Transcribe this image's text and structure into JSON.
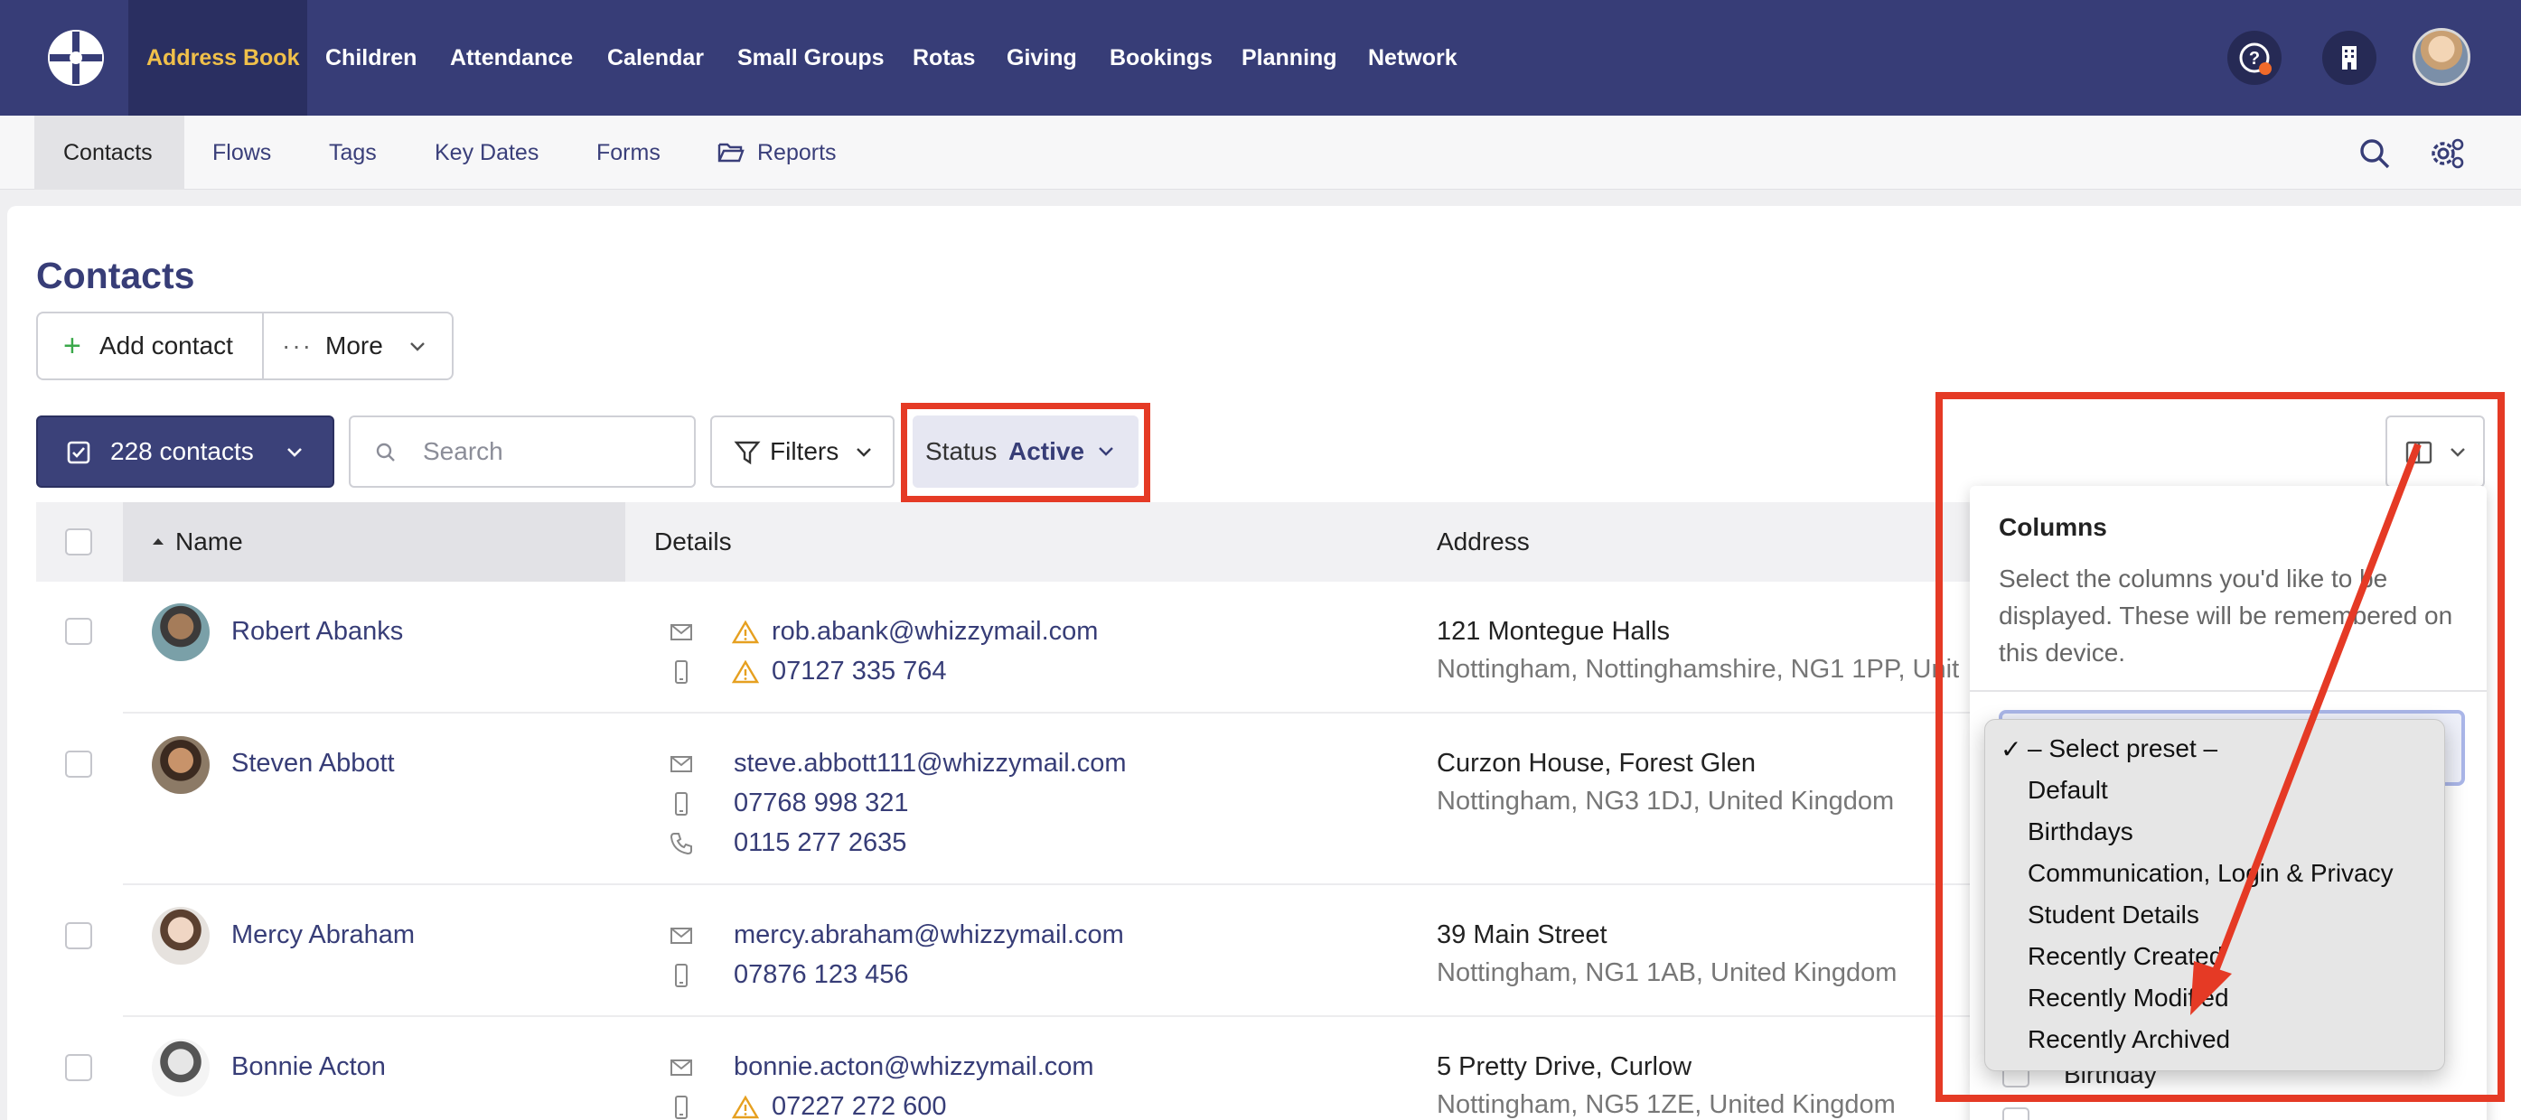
{
  "topnav": {
    "items": [
      {
        "label": "Address Book",
        "active": true
      },
      {
        "label": "Children"
      },
      {
        "label": "Attendance"
      },
      {
        "label": "Calendar"
      },
      {
        "label": "Small Groups"
      },
      {
        "label": "Rotas"
      },
      {
        "label": "Giving"
      },
      {
        "label": "Bookings"
      },
      {
        "label": "Planning"
      },
      {
        "label": "Network"
      }
    ],
    "icons": [
      "help-icon",
      "building-icon",
      "user-avatar"
    ]
  },
  "subnav": {
    "items": [
      {
        "label": "Contacts",
        "active": true
      },
      {
        "label": "Flows"
      },
      {
        "label": "Tags"
      },
      {
        "label": "Key Dates"
      },
      {
        "label": "Forms"
      },
      {
        "label": "Reports",
        "icon": "folder-open-icon"
      }
    ]
  },
  "page": {
    "title": "Contacts",
    "add_contact": "Add contact",
    "more": "More",
    "contacts_count": "228 contacts",
    "search_placeholder": "Search",
    "filters": "Filters",
    "status_label": "Status",
    "status_value": "Active"
  },
  "table": {
    "columns": [
      "Name",
      "Details",
      "Address"
    ],
    "rows": [
      {
        "name": "Robert Abanks",
        "details": [
          {
            "type": "email",
            "value": "rob.abank@whizzymail.com",
            "warning": true
          },
          {
            "type": "mobile",
            "value": "07127 335 764",
            "warning": true
          }
        ],
        "address_line1": "121 Montegue Halls",
        "address_line2": "Nottingham, Nottinghamshire, NG1 1PP, Unit"
      },
      {
        "name": "Steven Abbott",
        "details": [
          {
            "type": "email",
            "value": "steve.abbott111@whizzymail.com"
          },
          {
            "type": "mobile",
            "value": "07768 998 321"
          },
          {
            "type": "phone",
            "value": "0115 277 2635"
          }
        ],
        "address_line1": "Curzon House, Forest Glen",
        "address_line2": "Nottingham, NG3 1DJ, United Kingdom"
      },
      {
        "name": "Mercy Abraham",
        "details": [
          {
            "type": "email",
            "value": "mercy.abraham@whizzymail.com"
          },
          {
            "type": "mobile",
            "value": "07876 123 456"
          }
        ],
        "address_line1": "39 Main Street",
        "address_line2": "Nottingham, NG1 1AB, United Kingdom"
      },
      {
        "name": "Bonnie Acton",
        "details": [
          {
            "type": "email",
            "value": "bonnie.acton@whizzymail.com"
          },
          {
            "type": "mobile",
            "value": "07227 272 600",
            "warning": true
          }
        ],
        "address_line1": "5 Pretty Drive, Curlow",
        "address_line2": "Nottingham, NG5 1ZE, United Kingdom"
      }
    ]
  },
  "columns_panel": {
    "title": "Columns",
    "description": "Select the columns you'd like to be displayed. These will be remembered on this device.",
    "preset_options": [
      "– Select preset –",
      "Default",
      "Birthdays",
      "Communication, Login & Privacy",
      "Student Details",
      "Recently Created",
      "Recently Modified",
      "Recently Archived"
    ],
    "selected_option_check": "✓",
    "visible_column_option": "Birthday"
  },
  "colors": {
    "nav_bg": "#373d77",
    "accent_yellow": "#f0c04a",
    "link": "#373d77",
    "highlight_red": "#e53a25",
    "warning": "#e6a020"
  }
}
